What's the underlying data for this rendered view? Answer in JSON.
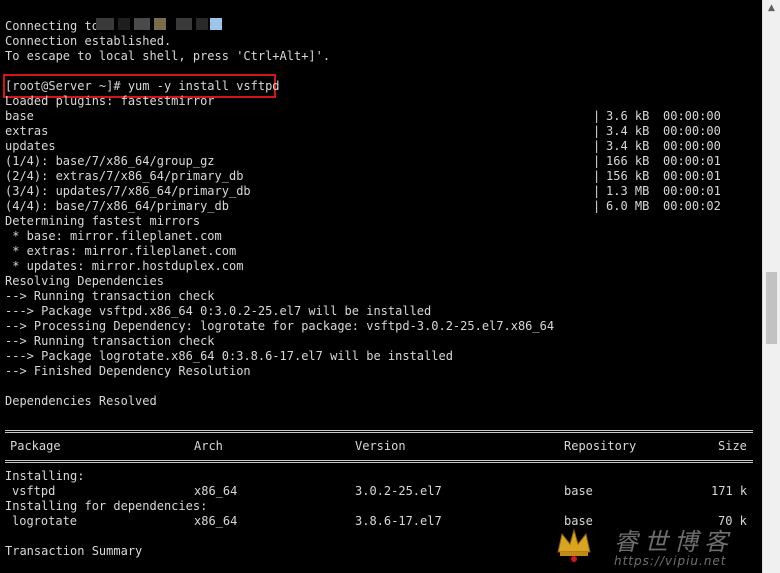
{
  "terminal": {
    "header": {
      "connecting": "Connecting to",
      "established": "Connection established.",
      "escape_hint": "To escape to local shell, press 'Ctrl+Alt+]'."
    },
    "command_line": "[root@Server ~]# yum -y install vsftpd",
    "loaded_plugins": "Loaded plugins: fastestmirror",
    "repo_rows": [
      {
        "name": "base",
        "size": "3.6 kB",
        "time": "00:00:00"
      },
      {
        "name": "extras",
        "size": "3.4 kB",
        "time": "00:00:00"
      },
      {
        "name": "updates",
        "size": "3.4 kB",
        "time": "00:00:00"
      },
      {
        "name": "(1/4): base/7/x86_64/group_gz",
        "size": "166 kB",
        "time": "00:00:01"
      },
      {
        "name": "(2/4): extras/7/x86_64/primary_db",
        "size": "156 kB",
        "time": "00:00:01"
      },
      {
        "name": "(3/4): updates/7/x86_64/primary_db",
        "size": "1.3 MB",
        "time": "00:00:01"
      },
      {
        "name": "(4/4): base/7/x86_64/primary_db",
        "size": "6.0 MB",
        "time": "00:00:02"
      }
    ],
    "log_lines": [
      "Determining fastest mirrors",
      " * base: mirror.fileplanet.com",
      " * extras: mirror.fileplanet.com",
      " * updates: mirror.hostduplex.com",
      "Resolving Dependencies",
      "--> Running transaction check",
      "---> Package vsftpd.x86_64 0:3.0.2-25.el7 will be installed",
      "--> Processing Dependency: logrotate for package: vsftpd-3.0.2-25.el7.x86_64",
      "--> Running transaction check",
      "---> Package logrotate.x86_64 0:3.8.6-17.el7 will be installed",
      "--> Finished Dependency Resolution"
    ],
    "deps_resolved": "Dependencies Resolved",
    "table": {
      "headers": {
        "package": "Package",
        "arch": "Arch",
        "version": "Version",
        "repository": "Repository",
        "size": "Size"
      },
      "installing_label": "Installing:",
      "installing_rows": [
        {
          "package": "vsftpd",
          "arch": "x86_64",
          "version": "3.0.2-25.el7",
          "repository": "base",
          "size": "171 k"
        }
      ],
      "deps_label": "Installing for dependencies:",
      "dep_rows": [
        {
          "package": "logrotate",
          "arch": "x86_64",
          "version": "3.8.6-17.el7",
          "repository": "base",
          "size": "70 k"
        }
      ]
    },
    "transaction_summary": "Transaction Summary"
  },
  "watermark": {
    "text": "睿世博客",
    "url": "https://vipiu.net"
  },
  "colors": {
    "background": "#000000",
    "foreground": "#d8d8d8",
    "highlight_border": "#d4131a"
  },
  "scrollbar": {
    "up_arrow": "chevron-up-icon"
  }
}
